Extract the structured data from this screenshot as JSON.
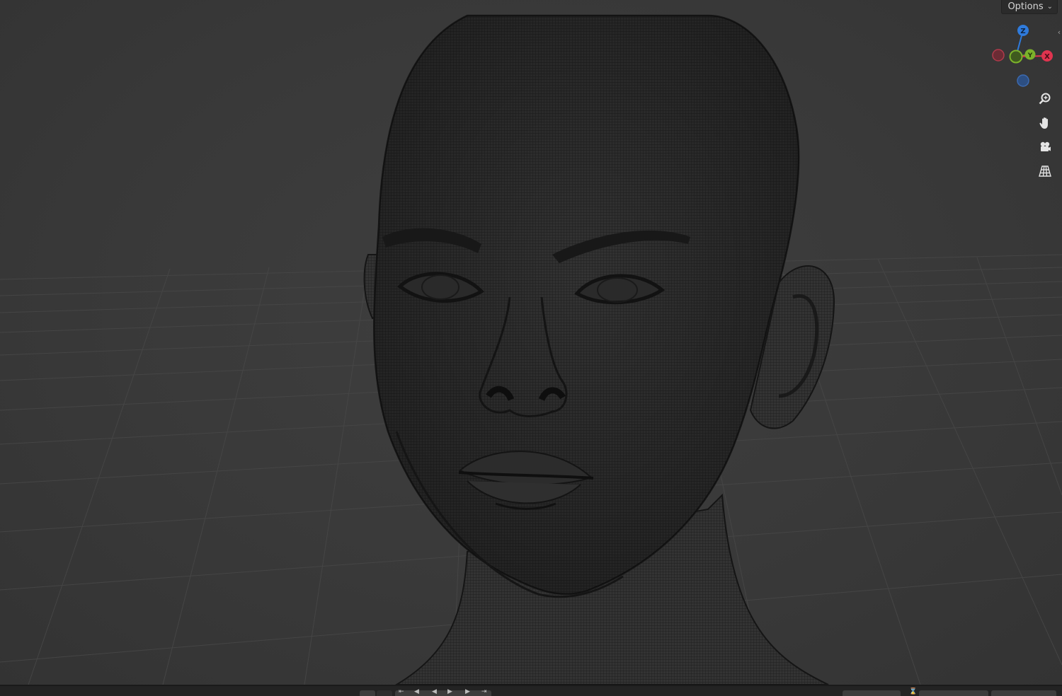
{
  "header": {
    "options_label": "Options",
    "options_chevron": "chevron-down-icon",
    "sidebar_toggle": "chevron-left-icon"
  },
  "gizmo": {
    "axes": [
      {
        "name": "Z",
        "color": "#2f7bdc",
        "labeled": true
      },
      {
        "name": "Y",
        "color": "#7bb22a",
        "labeled": true
      },
      {
        "name": "X",
        "color": "#e0344f",
        "labeled": true
      },
      {
        "name": "-X",
        "color": "#b03a4b",
        "labeled": false
      },
      {
        "name": "-Y",
        "color": "#6a8f26",
        "labeled": false
      },
      {
        "name": "-Z",
        "color": "#3c6ab0",
        "labeled": false
      }
    ]
  },
  "tools": [
    {
      "name": "zoom",
      "icon": "zoom-magnifier-icon"
    },
    {
      "name": "pan",
      "icon": "hand-icon"
    },
    {
      "name": "camera",
      "icon": "camera-icon"
    },
    {
      "name": "perspective",
      "icon": "perspective-grid-icon"
    }
  ],
  "colors": {
    "background": "#3a3a3a",
    "mesh_wire": "#1e1e1e",
    "grid_line": "#444444",
    "text": "#d6d6d6"
  }
}
